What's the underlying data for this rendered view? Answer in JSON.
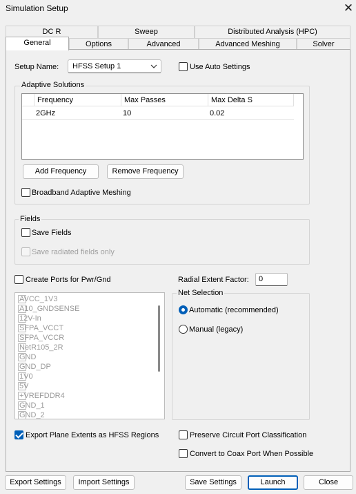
{
  "window": {
    "title": "Simulation Setup",
    "close_glyph": "✕"
  },
  "tabs_row1": [
    "DC R",
    "Sweep",
    "Distributed Analysis (HPC)"
  ],
  "tabs_row2": [
    "General",
    "Options",
    "Advanced",
    "Advanced Meshing",
    "Solver"
  ],
  "active_tab": "General",
  "setup_name": {
    "label": "Setup Name:",
    "value": "HFSS Setup 1"
  },
  "auto_settings": {
    "label": "Use Auto Settings",
    "checked": false
  },
  "adaptive": {
    "group_label": "Adaptive Solutions",
    "columns": [
      "Frequency",
      "Max Passes",
      "Max Delta S"
    ],
    "rows": [
      {
        "frequency": "2GHz",
        "max_passes": "10",
        "max_delta_s": "0.02"
      }
    ],
    "add_button": "Add Frequency",
    "remove_button": "Remove Frequency",
    "broadband_label": "Broadband Adaptive Meshing",
    "broadband_checked": false
  },
  "fields": {
    "group_label": "Fields",
    "save_fields_label": "Save Fields",
    "save_fields_checked": false,
    "save_radiated_label": "Save radiated fields only",
    "save_radiated_checked": false
  },
  "create_ports": {
    "label": "Create Ports for Pwr/Gnd",
    "checked": false
  },
  "radial_extent": {
    "label": "Radial Extent Factor:",
    "value": "0"
  },
  "net_list": [
    "AVCC_1V3",
    "A10_GNDSENSE",
    "12V-In",
    "SFPA_VCCT",
    "SFPA_VCCR",
    "NetR105_2R",
    "GND",
    "GND_DP",
    "1V0",
    "5V",
    "+VREFDDR4",
    "GND_1",
    "GND_2"
  ],
  "net_selection": {
    "group_label": "Net Selection",
    "options": [
      {
        "label": "Automatic (recommended)",
        "selected": true
      },
      {
        "label": "Manual (legacy)",
        "selected": false
      }
    ]
  },
  "export_plane": {
    "label": "Export Plane Extents as HFSS Regions",
    "checked": true
  },
  "preserve_port": {
    "label": "Preserve Circuit Port Classification",
    "checked": false
  },
  "convert_coax": {
    "label": "Convert to Coax Port When Possible",
    "checked": false
  },
  "footer": {
    "export_settings": "Export Settings",
    "import_settings": "Import Settings",
    "save_settings": "Save Settings",
    "launch": "Launch",
    "close": "Close"
  }
}
